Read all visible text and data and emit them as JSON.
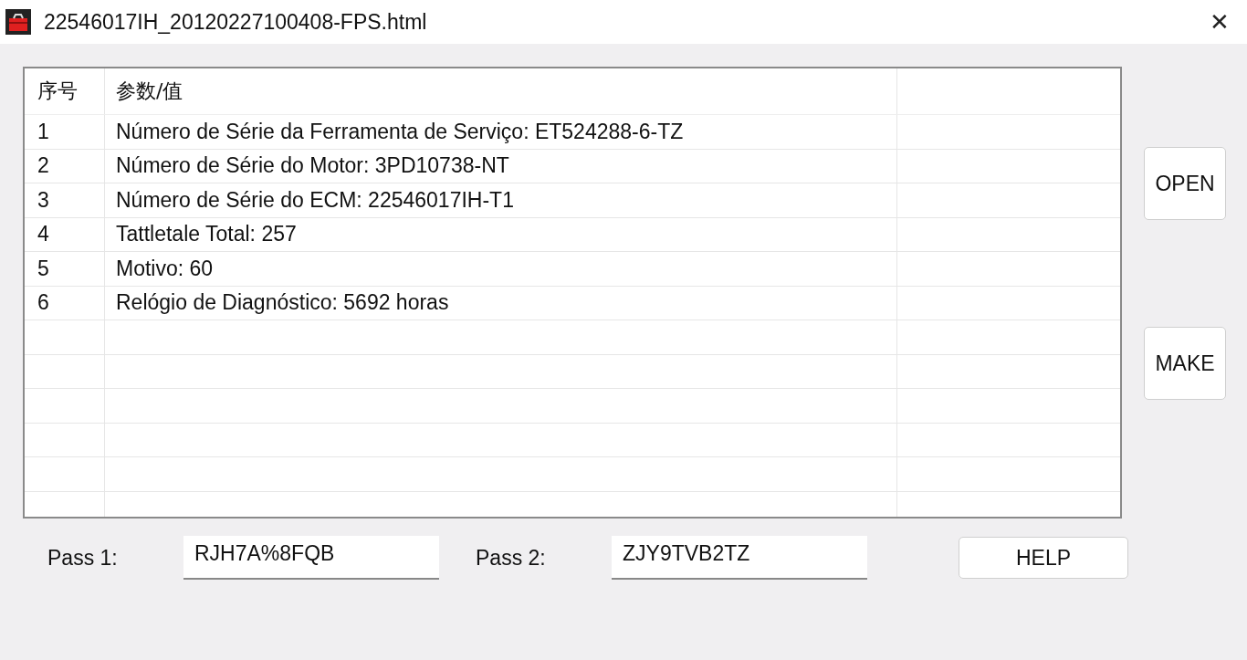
{
  "window": {
    "title": "22546017IH_20120227100408-FPS.html",
    "close": "✕"
  },
  "table": {
    "columns": [
      "序号",
      "参数/值"
    ],
    "rows": [
      {
        "index": "1",
        "value": "Número de Série da Ferramenta de Serviço: ET524288-6-TZ"
      },
      {
        "index": "2",
        "value": "Número de Série do Motor: 3PD10738-NT"
      },
      {
        "index": "3",
        "value": "Número de Série do ECM: 22546017IH-T1"
      },
      {
        "index": "4",
        "value": "Tattletale Total: 257"
      },
      {
        "index": "5",
        "value": "Motivo: 60"
      },
      {
        "index": "6",
        "value": "Relógio de Diagnóstico: 5692 horas"
      }
    ]
  },
  "side_buttons": [
    "OPEN",
    "MAKE"
  ],
  "pass_fields": [
    {
      "label": "Pass 1:",
      "value": "RJH7A%8FQB"
    },
    {
      "label": "Pass 2:",
      "value": "ZJY9TVB2TZ"
    }
  ],
  "help_button": "HELP"
}
